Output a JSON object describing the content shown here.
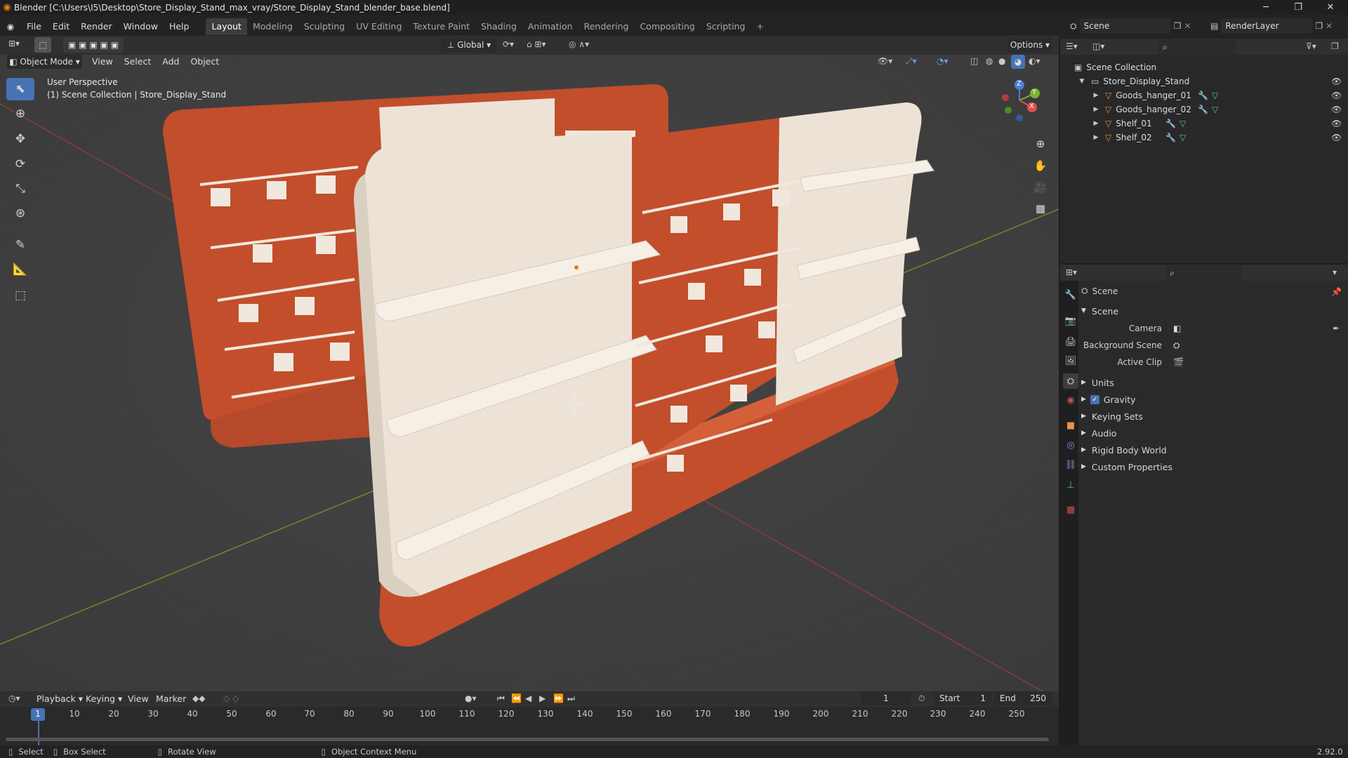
{
  "window": {
    "title": "Blender [C:\\Users\\I5\\Desktop\\Store_Display_Stand_max_vray/Store_Display_Stand_blender_base.blend]",
    "minimize": "─",
    "maximize": "❐",
    "close": "✕"
  },
  "menus": [
    "File",
    "Edit",
    "Render",
    "Window",
    "Help"
  ],
  "workspaces": [
    "Layout",
    "Modeling",
    "Sculpting",
    "UV Editing",
    "Texture Paint",
    "Shading",
    "Animation",
    "Rendering",
    "Compositing",
    "Scripting"
  ],
  "workspace_add": "+",
  "scene": {
    "name": "Scene",
    "render_layer": "RenderLayer"
  },
  "toolbar": {
    "transform_orientation": "Global",
    "options_label": "Options"
  },
  "viewport_header": {
    "mode": "Object Mode",
    "menus": [
      "View",
      "Select",
      "Add",
      "Object"
    ]
  },
  "viewport": {
    "perspective_label": "User Perspective",
    "collection_label": "(1) Scene Collection | Store_Display_Stand"
  },
  "gizmo_axes": {
    "x": "X",
    "y": "Y",
    "z": "Z"
  },
  "outliner": {
    "root": "Scene Collection",
    "collection": "Store_Display_Stand",
    "objects": [
      "Goods_hanger_01",
      "Goods_hanger_02",
      "Shelf_01",
      "Shelf_02"
    ]
  },
  "properties": {
    "context_name": "Scene",
    "panel_title": "Scene",
    "fields": [
      {
        "label": "Camera",
        "value": ""
      },
      {
        "label": "Background Scene",
        "value": ""
      },
      {
        "label": "Active Clip",
        "value": ""
      }
    ],
    "subpanels": [
      {
        "label": "Units",
        "checkbox": false
      },
      {
        "label": "Gravity",
        "checkbox": true,
        "checked": true
      },
      {
        "label": "Keying Sets",
        "checkbox": false
      },
      {
        "label": "Audio",
        "checkbox": false
      },
      {
        "label": "Rigid Body World",
        "checkbox": false
      },
      {
        "label": "Custom Properties",
        "checkbox": false
      }
    ]
  },
  "timeline": {
    "menus": [
      "Playback",
      "Keying",
      "View",
      "Marker"
    ],
    "current_frame": "1",
    "start_label": "Start",
    "start": "1",
    "end_label": "End",
    "end": "250",
    "ticks": [
      "1",
      "10",
      "20",
      "30",
      "40",
      "50",
      "60",
      "70",
      "80",
      "90",
      "100",
      "110",
      "120",
      "130",
      "140",
      "150",
      "160",
      "170",
      "180",
      "190",
      "200",
      "210",
      "220",
      "230",
      "240",
      "250"
    ]
  },
  "statusbar": {
    "items": [
      "Select",
      "Box Select",
      "Rotate View",
      "Object Context Menu"
    ],
    "version": "2.92.0"
  },
  "colors": {
    "accent_blue": "#4772b3",
    "brand_orange": "#e87d0d",
    "stand_red": "#c24e2c",
    "stand_cream": "#ece3d6"
  }
}
